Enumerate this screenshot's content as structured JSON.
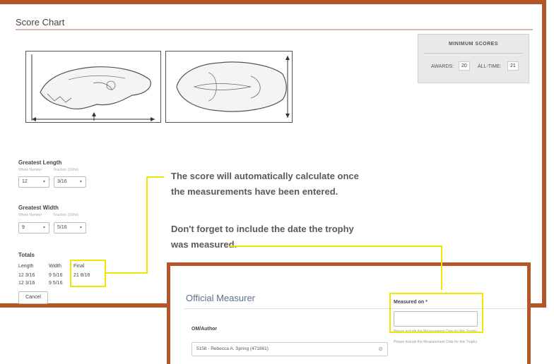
{
  "score_chart": {
    "title": "Score Chart",
    "minimum_scores": {
      "heading": "MINIMUM SCORES",
      "awards_label": "AWARDS:",
      "awards_value": "20",
      "alltime_label": "ALL-TIME:",
      "alltime_value": "21"
    },
    "greatest_length": {
      "heading": "Greatest Length",
      "whole_label": "Whole Number",
      "fraction_label": "Fraction (16ths)",
      "whole_value": "12",
      "fraction_value": "3/16"
    },
    "greatest_width": {
      "heading": "Greatest Width",
      "whole_label": "Whole Number",
      "fraction_label": "Fraction (16ths)",
      "whole_value": "9",
      "fraction_value": "5/16"
    },
    "totals": {
      "heading": "Totals",
      "columns": [
        "Length",
        "Width",
        "Final"
      ],
      "rows": [
        [
          "12 3/16",
          "9 5/16",
          "21 8/16"
        ],
        [
          "12 3/16",
          "9 5/16",
          ""
        ]
      ]
    },
    "cancel_label": "Cancel"
  },
  "callouts": {
    "score_line1": "The score will automatically calculate once",
    "score_line2": "the measurements have been entered.",
    "date_line1": "Don't forget to include the date the trophy",
    "date_line2": "was measured."
  },
  "official_measurer": {
    "title": "Official Measurer",
    "measured_on_label": "Measured on *",
    "measured_on_value": "",
    "help_text_1": "Please include the Measurement Date for this Trophy.",
    "help_text_2": "Please include the Measurement Date for this Trophy.",
    "author_label": "OM/Author",
    "author_value": "5158 - Rebecca A. Spring (471861)",
    "clear_symbol": "⊘"
  },
  "colors": {
    "frame": "#b4552a",
    "highlight": "#f2e600",
    "om_title": "#5b6f8c"
  }
}
